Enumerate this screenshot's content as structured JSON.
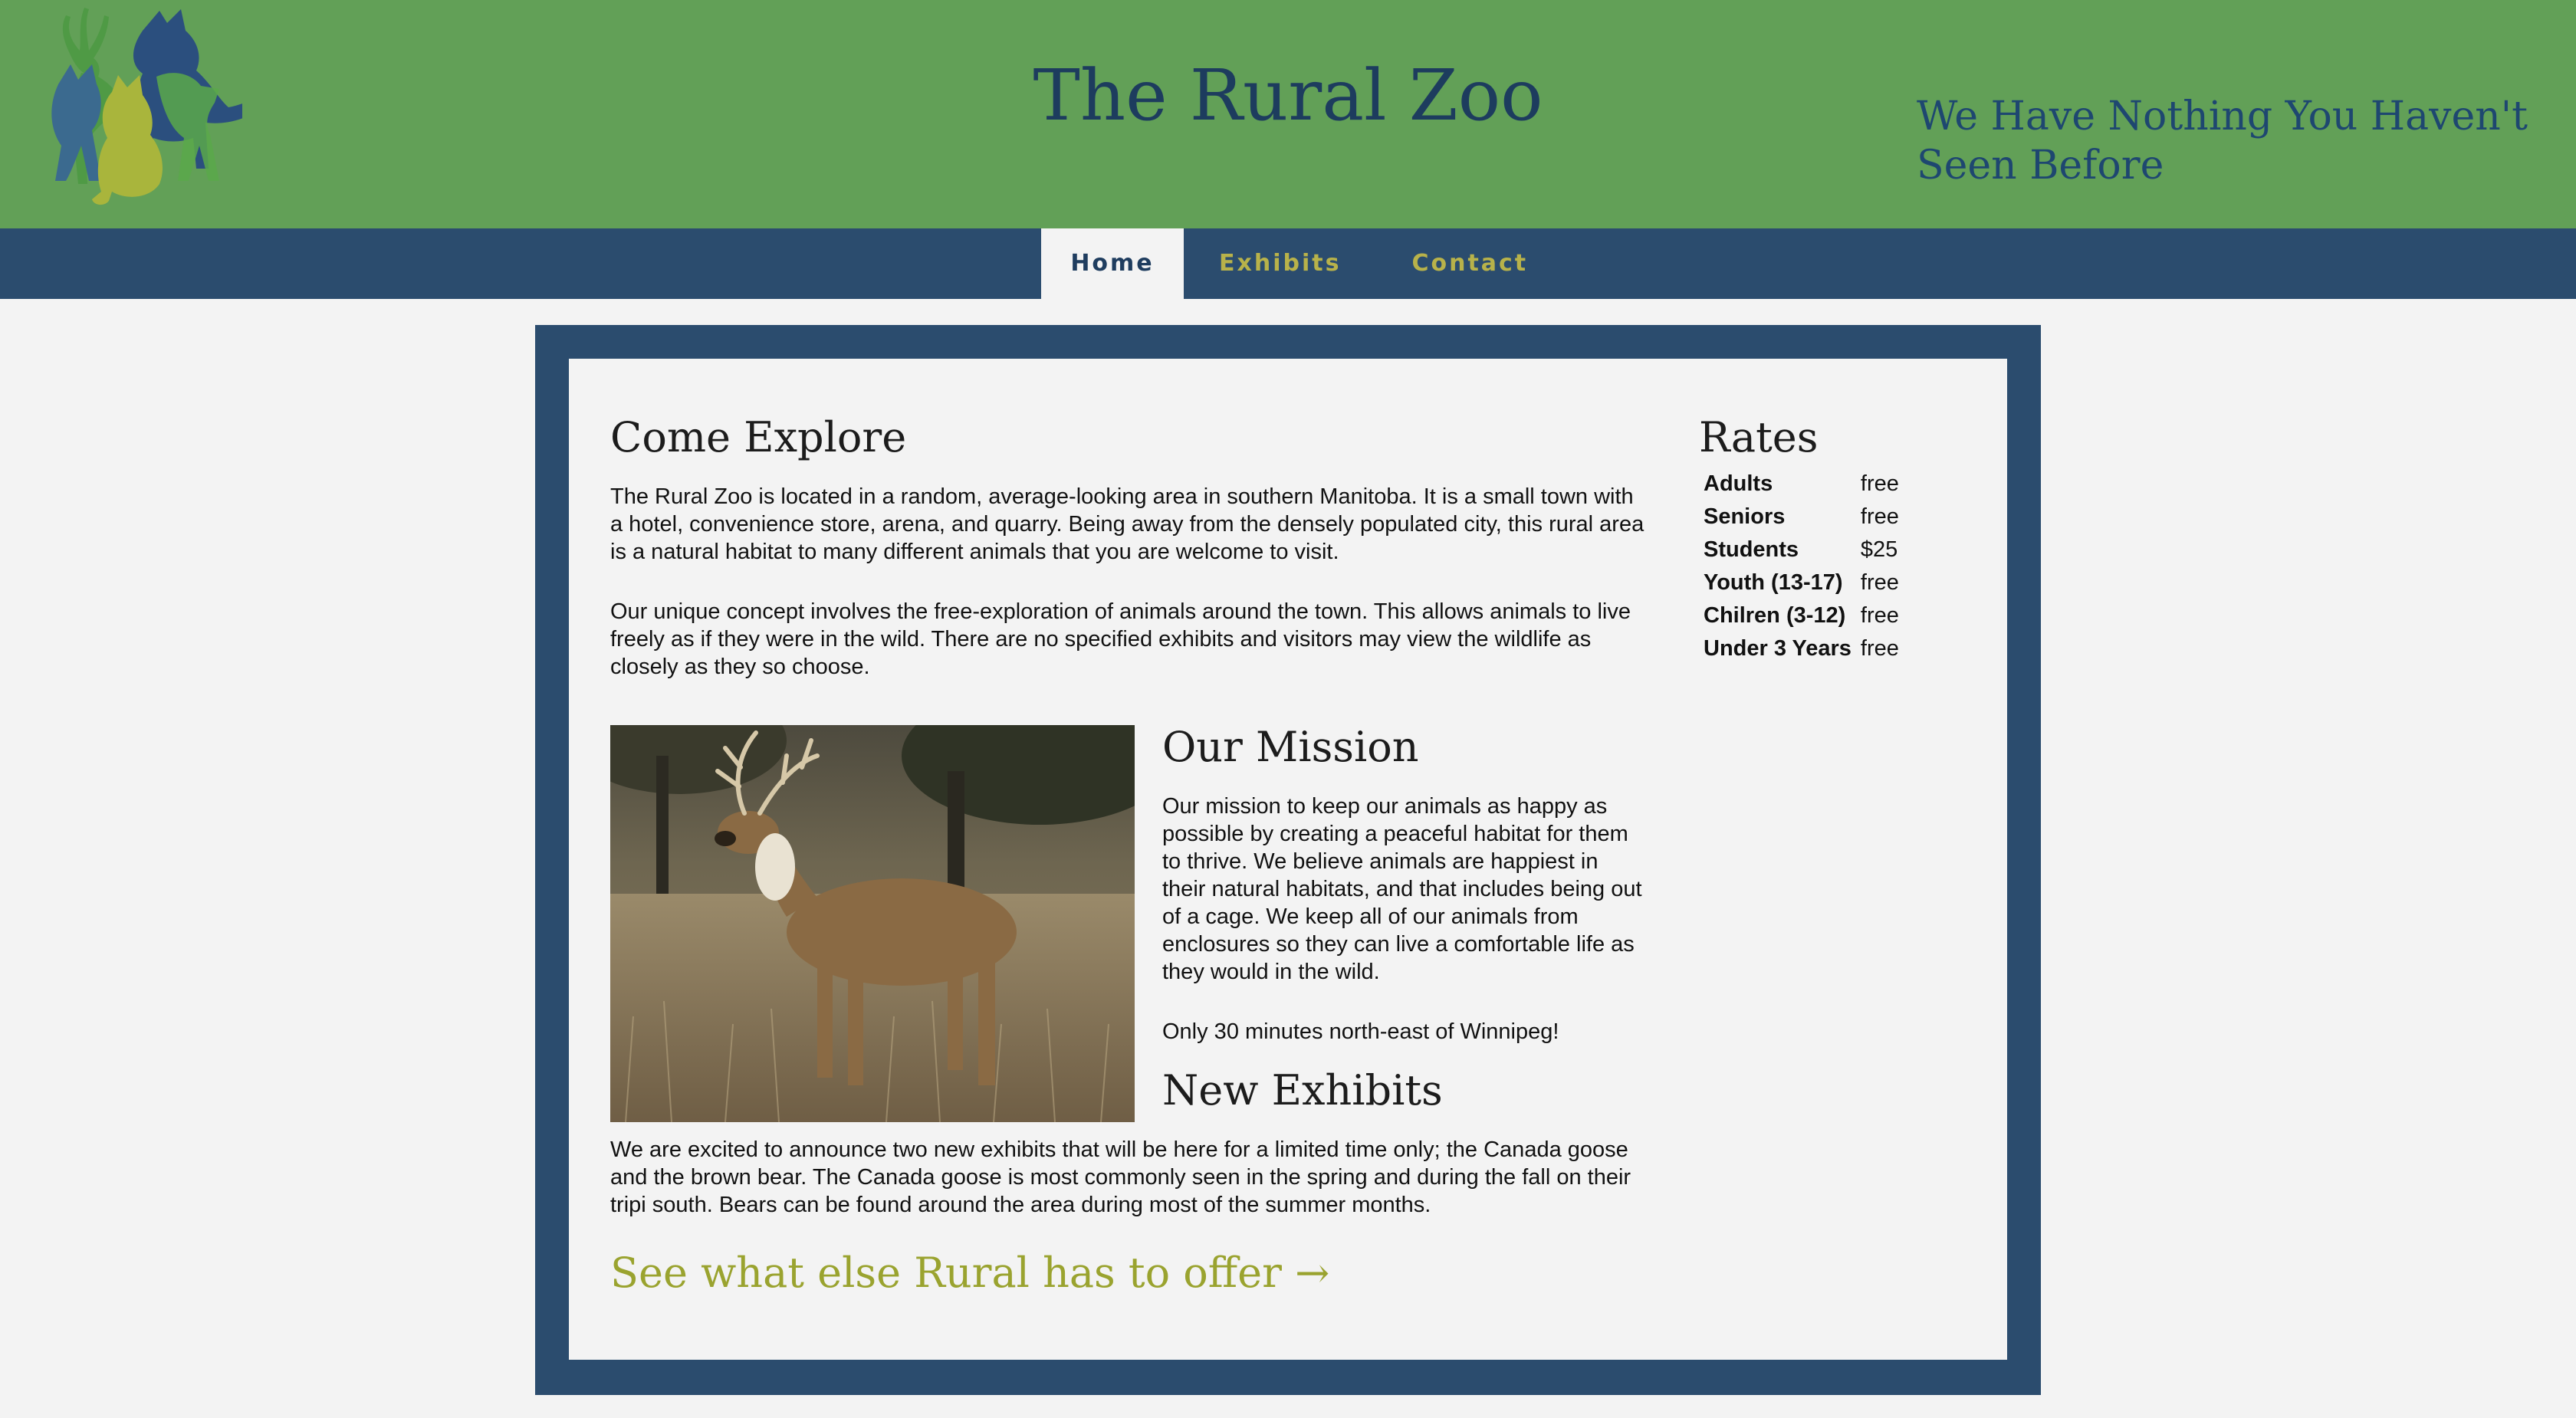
{
  "header": {
    "title": "The Rural Zoo",
    "tagline": "We Have Nothing You Haven't Seen Before"
  },
  "nav": {
    "items": [
      {
        "label": "Home",
        "active": true
      },
      {
        "label": "Exhibits",
        "active": false
      },
      {
        "label": "Contact",
        "active": false
      }
    ]
  },
  "main": {
    "explore_heading": "Come Explore",
    "explore_p1": "The Rural Zoo is located in a random, average-looking area in southern Manitoba. It is a small town with a hotel, convenience store, arena, and quarry. Being away from the densely populated city, this rural area is a natural habitat to many different animals that you are welcome to visit.",
    "explore_p2": "Our unique concept involves the free-exploration of animals around the town. This allows animals to live freely as if they were in the wild. There are no specified exhibits and visitors may view the wildlife as closely as they so choose.",
    "mission_heading": "Our Mission",
    "mission_p": "Our mission to keep our animals as happy as possible by creating a peaceful habitat for them to thrive. We believe animals are happiest in their natural habitats, and that includes being out of a cage. We keep all of our animals from enclosures so they can live a comfortable life as they would in the wild.",
    "location_p": "Only 30 minutes north-east of Winnipeg!",
    "new_heading": "New Exhibits",
    "new_p": "We are excited to announce two new exhibits that will be here for a limited time only; the Canada goose and the brown bear. The Canada goose is most commonly seen in the spring and during the fall on their tripi south. Bears can be found around the area during most of the summer months.",
    "cta": "See what else Rural has to offer →"
  },
  "rates": {
    "heading": "Rates",
    "rows": [
      {
        "label": "Adults",
        "price": "free"
      },
      {
        "label": "Seniors",
        "price": "free"
      },
      {
        "label": "Students",
        "price": "$25"
      },
      {
        "label": "Youth (13-17)",
        "price": "free"
      },
      {
        "label": "Chilren (3-12)",
        "price": "free"
      },
      {
        "label": "Under 3 Years",
        "price": "free"
      }
    ]
  },
  "colors": {
    "header_green": "#62a057",
    "nav_blue": "#2b4c6e",
    "accent_olive": "#9aa32f",
    "title_navy": "#1d3c5e"
  },
  "icons": {
    "logo": "animal-silhouettes-logo",
    "photo": "white-tailed-deer-photo"
  }
}
